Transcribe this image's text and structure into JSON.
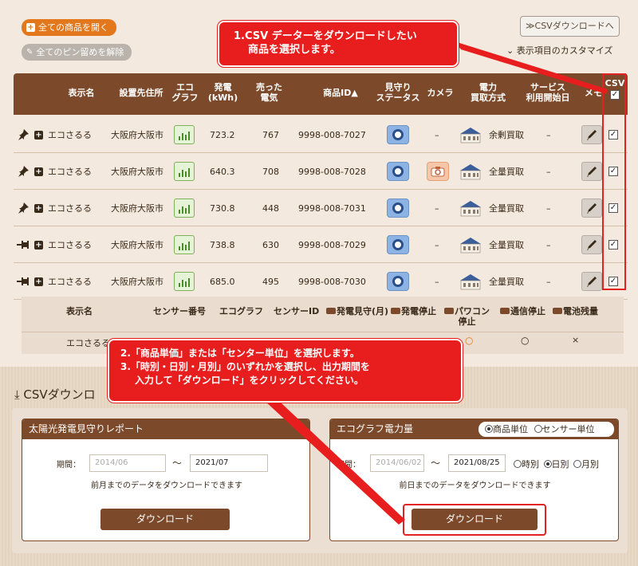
{
  "top_buttons": {
    "open_all": "全ての商品を開く",
    "unpin_all": "全てのピン留めを解除",
    "csv_download": "≫CSVダウンロードへ",
    "customize": "表示項目のカスタマイズ"
  },
  "callout1": {
    "line1": "1.CSV データーをダウンロードしたい",
    "line2": "商品を選択します。"
  },
  "table_headers": {
    "name": "表示名",
    "location": "設置先住所",
    "ecograph": [
      "エコ",
      "グラフ"
    ],
    "generation": [
      "発電",
      "(kWh)"
    ],
    "sold": [
      "売った",
      "電気"
    ],
    "product_id": "商品ID▲",
    "monitoring": [
      "見守り",
      "ステータス"
    ],
    "camera": "カメラ",
    "power_method": [
      "電力",
      "買取方式"
    ],
    "service_start": [
      "サービス",
      "利用開始日"
    ],
    "memo": "メモ",
    "csv": "CSV"
  },
  "rows": [
    {
      "pin": "pushpin",
      "name": "エコさるる",
      "location": "大阪府大阪市",
      "generation": "723.2",
      "sold": "767",
      "product_id": "9998-008-7027",
      "camera": "–",
      "method": "余剰買取",
      "service": "–",
      "checked": true
    },
    {
      "pin": "pushpin",
      "name": "エコさるる",
      "location": "大阪府大阪市",
      "generation": "640.3",
      "sold": "708",
      "product_id": "9998-008-7028",
      "camera": "camera",
      "method": "全量買取",
      "service": "–",
      "checked": true
    },
    {
      "pin": "pushpin",
      "name": "エコさるる",
      "location": "大阪府大阪市",
      "generation": "730.8",
      "sold": "448",
      "product_id": "9998-008-7031",
      "camera": "–",
      "method": "全量買取",
      "service": "–",
      "checked": true
    },
    {
      "pin": "unpinned",
      "name": "エコさるる",
      "location": "大阪府大阪市",
      "generation": "738.8",
      "sold": "630",
      "product_id": "9998-008-7029",
      "camera": "–",
      "method": "全量買取",
      "service": "–",
      "checked": true
    },
    {
      "pin": "unpinned",
      "name": "エコさるる",
      "location": "大阪府大阪市",
      "generation": "685.0",
      "sold": "495",
      "product_id": "9998-008-7030",
      "camera": "–",
      "method": "全量買取",
      "service": "–",
      "checked": true
    }
  ],
  "sub_headers": {
    "name": "表示名",
    "sensor_no": "センサー番号",
    "ecograph": "エコグラフ",
    "sensor_id": "センサーID",
    "gen_monitor": "発電見守(月)",
    "gen_stop": "発電停止",
    "pc_stop": [
      "パワコン",
      "停止"
    ],
    "comm_stop": "通信停止",
    "battery": "電池残量"
  },
  "sub_row": {
    "name": "エコさるる",
    "pc_stop": "○",
    "comm_stop": "○",
    "battery": "×"
  },
  "callout2": {
    "line1": "2.「商品単価」または「センター単位」を選択します。",
    "line2": "3.「時別・日別・月別」のいずれかを選択し、出力期間を",
    "line3": "入力して「ダウンロード」をクリックしてください。"
  },
  "csv_section_title": "CSVダウンロ",
  "solar_report": {
    "title": "太陽光発電見守りレポート",
    "period_label": "期間：",
    "start_placeholder": "2014/06",
    "end_value": "2021/07",
    "tilde": "～",
    "note": "前月までのデータをダウンロードできます",
    "button": "ダウンロード"
  },
  "ecograph_power": {
    "title": "エコグラフ電力量",
    "unit_product": "商品単位",
    "unit_sensor": "センサー単位",
    "period_label": "期間：",
    "start_placeholder": "2014/06/02",
    "end_value": "2021/08/25",
    "tilde": "～",
    "hourly": "時別",
    "daily": "日別",
    "monthly": "月別",
    "note": "前日までのデータをダウンロードできます",
    "button": "ダウンロード"
  },
  "colors": {
    "brown": "#7c4a2a",
    "orange": "#e2771c",
    "red": "#e81e1e",
    "blue_status": "#8cb3e3"
  }
}
